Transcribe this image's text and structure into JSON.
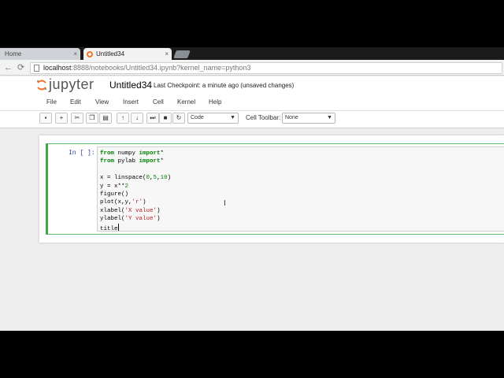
{
  "browser": {
    "tabs": [
      {
        "label": "Home",
        "active": false
      },
      {
        "label": "Untitled34",
        "active": true
      }
    ],
    "close_glyph": "×",
    "url_host": "localhost",
    "url_rest": ":8888/notebooks/Untitled34.ipynb?kernel_name=python3"
  },
  "jupyter": {
    "logo_text": "jupyter",
    "notebook_name": "Untitled34",
    "checkpoint": "Last Checkpoint: a minute ago (unsaved changes)"
  },
  "menu": [
    "File",
    "Edit",
    "View",
    "Insert",
    "Cell",
    "Kernel",
    "Help"
  ],
  "toolbar": {
    "cell_type": "Code",
    "cell_toolbar_label": "Cell Toolbar:",
    "cell_toolbar_value": "None"
  },
  "cell": {
    "prompt": "In [ ]:",
    "lines": [
      "from numpy import*",
      "from pylab import*",
      "",
      "x = linspace(0,5,10)",
      "y = x**2",
      "figure()",
      "plot(x,y,'r')",
      "xlabel('X value')",
      "ylabel('Y value')",
      "title"
    ]
  },
  "colors": {
    "accent_orange": "#f37626",
    "cell_border_green": "#42a642",
    "prompt_blue": "#303f9f"
  }
}
